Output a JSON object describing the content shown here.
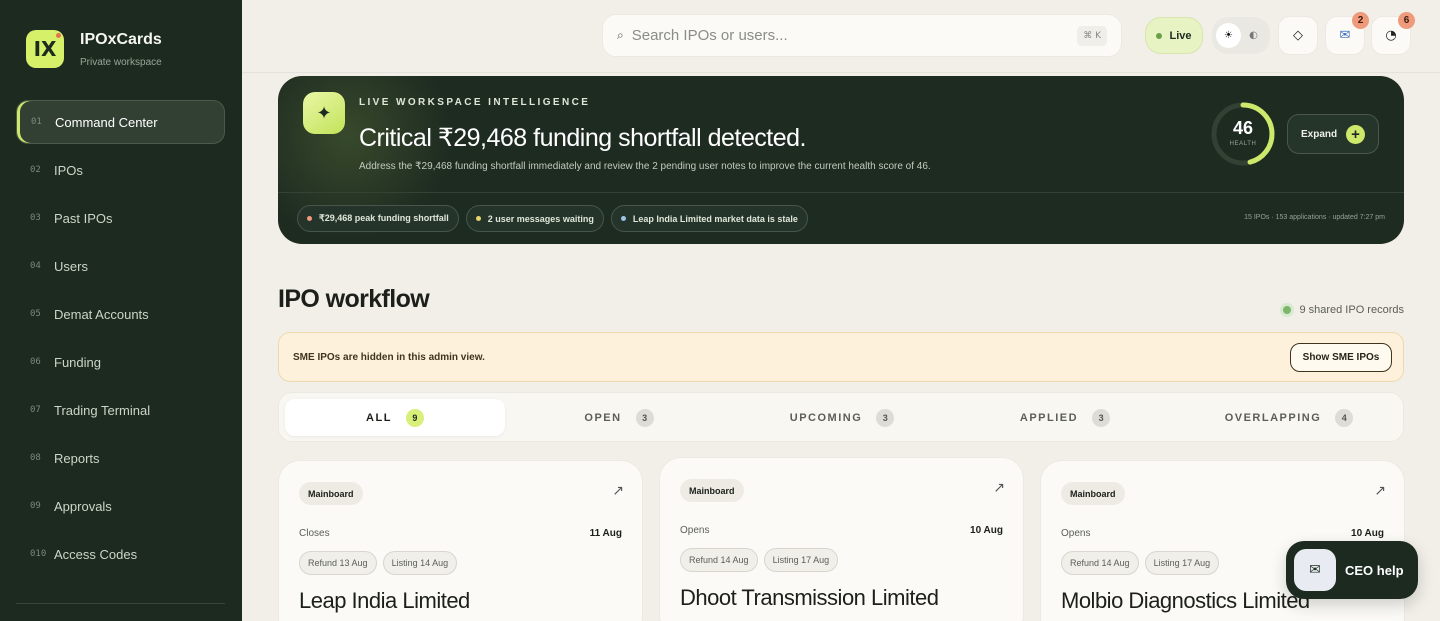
{
  "brand": {
    "logo": "IX",
    "name": "IPOxCards",
    "subtitle": "Private workspace"
  },
  "sidebar": {
    "items": [
      {
        "num": "01",
        "label": "Command Center",
        "active": true
      },
      {
        "num": "02",
        "label": "IPOs"
      },
      {
        "num": "03",
        "label": "Past IPOs"
      },
      {
        "num": "04",
        "label": "Users"
      },
      {
        "num": "05",
        "label": "Demat Accounts"
      },
      {
        "num": "06",
        "label": "Funding"
      },
      {
        "num": "07",
        "label": "Trading Terminal"
      },
      {
        "num": "08",
        "label": "Reports"
      },
      {
        "num": "09",
        "label": "Approvals"
      },
      {
        "num": "010",
        "label": "Access Codes"
      }
    ]
  },
  "topbar": {
    "search_placeholder": "Search IPOs or users...",
    "search_shortcut": "⌘ K",
    "live_label": "Live",
    "theme_light_icon": "☀",
    "theme_dark_icon": "◐",
    "messages_badge": "2",
    "notifications_badge": "6"
  },
  "hero": {
    "kicker": "LIVE WORKSPACE INTELLIGENCE",
    "title": "Critical ₹29,468 funding shortfall detected.",
    "description": "Address the ₹29,468 funding shortfall immediately and review the 2 pending user notes to improve the current health score of 46.",
    "health_value": "46",
    "health_label": "HEALTH",
    "health_score": 46,
    "expand_label": "Expand",
    "chips": [
      {
        "label": "₹29,468 peak funding shortfall",
        "color": "#ef9a7a"
      },
      {
        "label": "2 user messages waiting",
        "color": "#e8d46a"
      },
      {
        "label": "Leap India Limited market data is stale",
        "color": "#9ec3e8"
      }
    ],
    "meta": "15 IPOs · 153 applications · updated 7:27 pm"
  },
  "workflow": {
    "title": "IPO workflow",
    "shared_label": "9 shared IPO records",
    "notice_text": "SME IPOs are hidden in this admin view.",
    "notice_button": "Show SME IPOs",
    "tabs": [
      {
        "label": "ALL",
        "count": "9"
      },
      {
        "label": "OPEN",
        "count": "3"
      },
      {
        "label": "UPCOMING",
        "count": "3"
      },
      {
        "label": "APPLIED",
        "count": "3"
      },
      {
        "label": "OVERLAPPING",
        "count": "4"
      }
    ]
  },
  "cards": [
    {
      "tag": "Mainboard",
      "date_label": "Closes",
      "date": "11 Aug",
      "refund": "Refund 13 Aug",
      "listing": "Listing 14 Aug",
      "name": "Leap India Limited"
    },
    {
      "tag": "Mainboard",
      "date_label": "Opens",
      "date": "10 Aug",
      "refund": "Refund 14 Aug",
      "listing": "Listing 17 Aug",
      "name": "Dhoot Transmission Limited"
    },
    {
      "tag": "Mainboard",
      "date_label": "Opens",
      "date": "10 Aug",
      "refund": "Refund 14 Aug",
      "listing": "Listing 17 Aug",
      "name": "Molbio Diagnostics Limited"
    }
  ],
  "ceo_help": {
    "label": "CEO help"
  },
  "colors": {
    "sidebar_bg": "#1c2a20",
    "accent": "#cde86a",
    "hero_bg": "#1e2b21",
    "notice_bg": "#fdf1dc"
  }
}
